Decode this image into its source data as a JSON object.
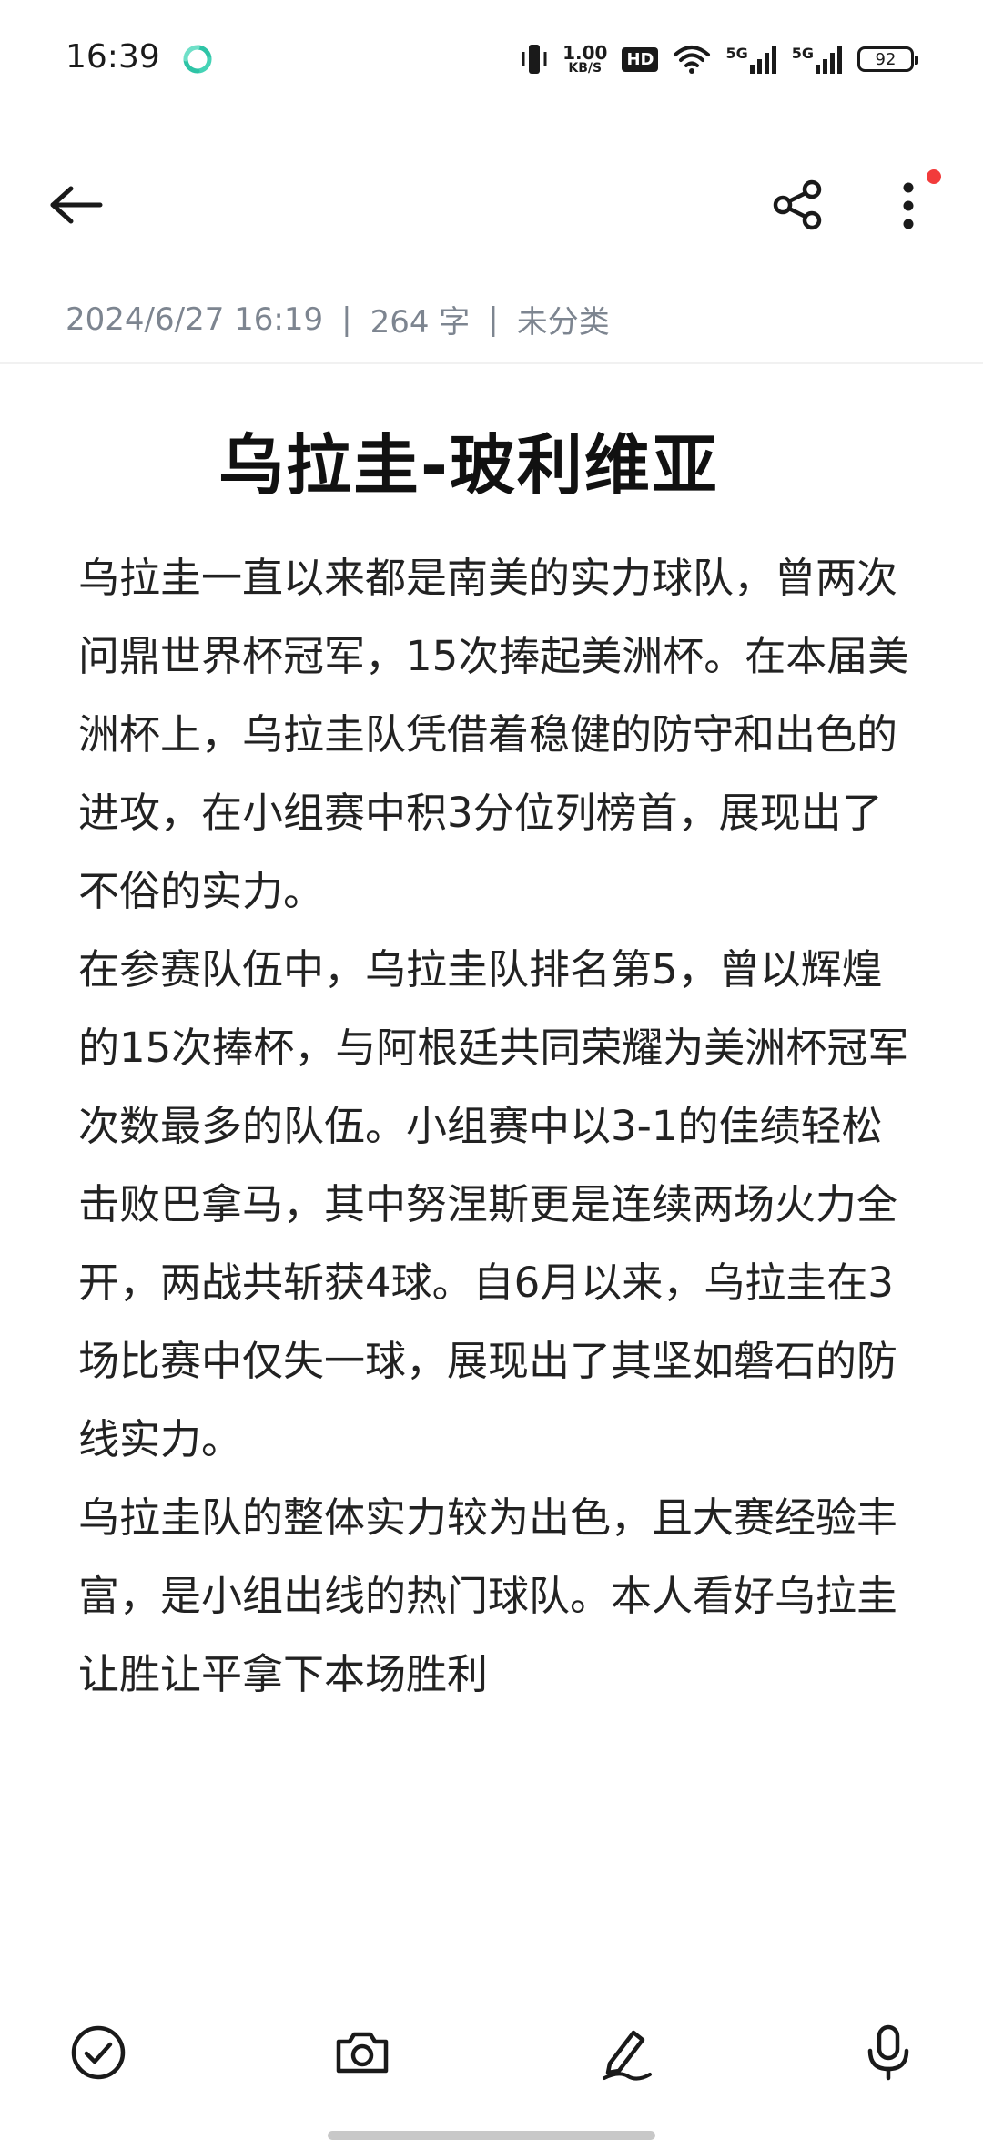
{
  "status_bar": {
    "time": "16:39",
    "net_speed_value": "1.00",
    "net_speed_unit": "KB/S",
    "hd_label": "HD",
    "sim1": "5G",
    "sim2": "5G",
    "battery": "92"
  },
  "meta": {
    "date": "2024/6/27 16:19",
    "separator": "|",
    "word_count": "264 字",
    "category": "未分类"
  },
  "note": {
    "title": "乌拉圭-玻利维亚",
    "paragraphs": [
      "乌拉圭一直以来都是南美的实力球队，曾两次问鼎世界杯冠军，15次捧起美洲杯。在本届美洲杯上，乌拉圭队凭借着稳健的防守和出色的进攻，在小组赛中积3分位列榜首，展现出了不俗的实力。",
      "在参赛队伍中，乌拉圭队排名第5，曾以辉煌的15次捧杯，与阿根廷共同荣耀为美洲杯冠军次数最多的队伍。小组赛中以3-1的佳绩轻松击败巴拿马，其中努涅斯更是连续两场火力全开，两战共斩获4球。自6月以来，乌拉圭在3场比赛中仅失一球，展现出了其坚如磐石的防线实力。",
      "乌拉圭队的整体实力较为出色，且大赛经验丰富，是小组出线的热门球队。本人看好乌拉圭让胜让平拿下本场胜利"
    ]
  },
  "colors": {
    "accent_app_icon": "#2ec4a6",
    "notify_dot": "#f23b3b",
    "meta_text": "#7d8590",
    "body_text": "#222222"
  },
  "icons": {
    "back": "arrow-left-icon",
    "share": "share-icon",
    "more": "more-vertical-icon",
    "checklist": "check-circle-icon",
    "camera": "camera-icon",
    "handwrite": "pen-icon",
    "voice": "microphone-icon"
  }
}
